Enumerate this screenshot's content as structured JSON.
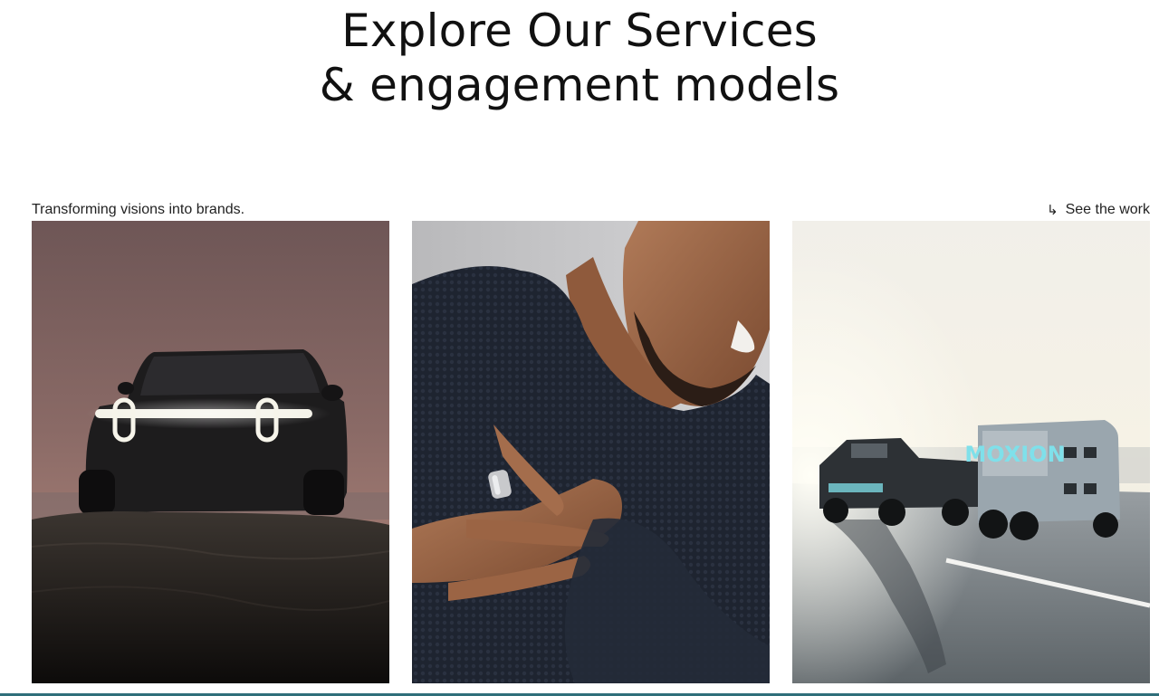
{
  "hero": {
    "title_line1": "Explore Our Services",
    "title_line2": "& engagement models"
  },
  "section": {
    "tagline": "Transforming visions into brands.",
    "see_work_arrow": "↳",
    "see_work_label": "See the work"
  },
  "tiles": [
    {
      "subject": "truck-at-dusk-image"
    },
    {
      "subject": "man-with-smart-ring-image"
    },
    {
      "subject": "pickup-towing-trailer-image",
      "brand_text": "MOXION"
    }
  ],
  "colors": {
    "accent_rule": "#2f6f7a",
    "text": "#111111"
  }
}
